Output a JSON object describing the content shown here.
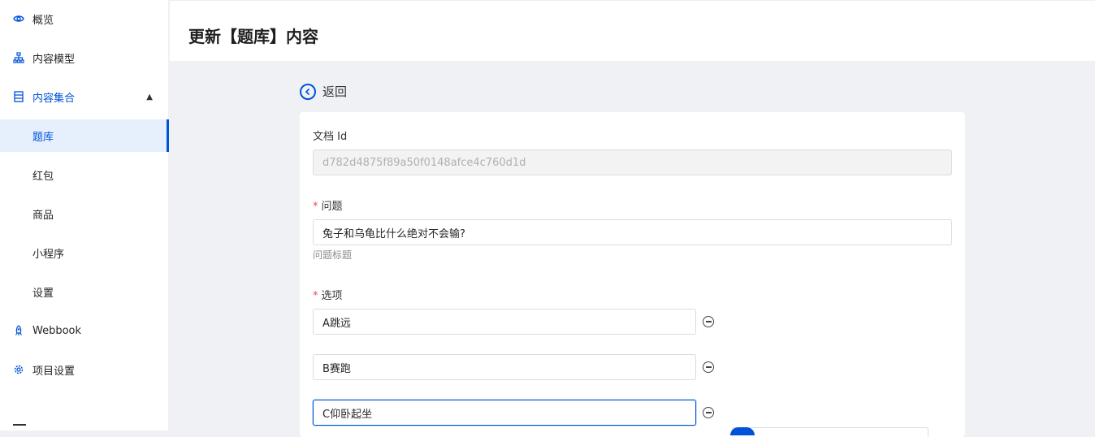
{
  "sidebar": {
    "items": [
      {
        "label": "概览",
        "icon": "eye-icon"
      },
      {
        "label": "内容模型",
        "icon": "sitemap-icon"
      },
      {
        "label": "内容集合",
        "icon": "database-icon"
      },
      {
        "label": "题库"
      },
      {
        "label": "红包"
      },
      {
        "label": "商品"
      },
      {
        "label": "小程序"
      },
      {
        "label": "设置"
      },
      {
        "label": "Webbook",
        "icon": "rocket-icon"
      },
      {
        "label": "项目设置",
        "icon": "gear-icon"
      }
    ],
    "active": "题库"
  },
  "header": {
    "title": "更新【题库】内容"
  },
  "back": {
    "label": "返回"
  },
  "form": {
    "doc_id_label": "文档 Id",
    "doc_id_value": "d782d4875f89a50f0148afce4c760d1d",
    "question_label": "问题",
    "question_value": "兔子和乌龟比什么绝对不会输?",
    "question_hint": "问题标题",
    "options_label": "选项",
    "options": [
      "A跳远",
      "B赛跑",
      "C仰卧起坐"
    ],
    "required_mark": "*"
  },
  "colors": {
    "accent": "#0052d9",
    "required": "#e34d59"
  }
}
